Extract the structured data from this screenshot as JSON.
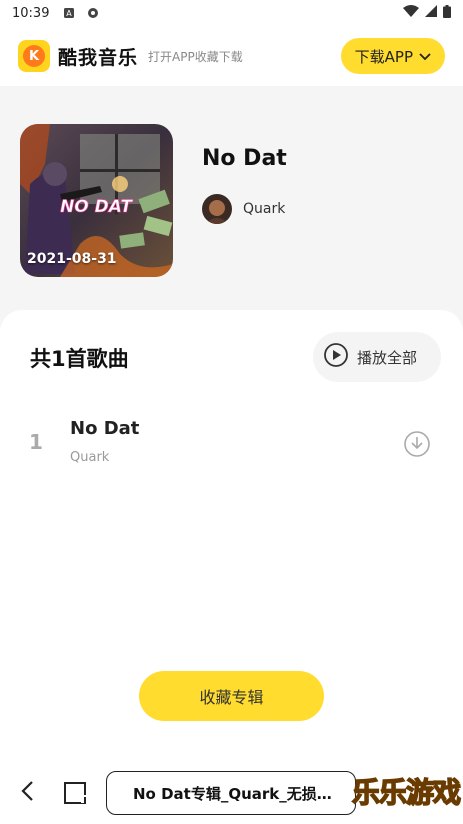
{
  "status_bar": {
    "time": "10:39"
  },
  "header": {
    "app_name": "酷我音乐",
    "tagline": "打开APP收藏下载",
    "download_button": "下载APP"
  },
  "album": {
    "title": "No Dat",
    "date": "2021-08-31",
    "artist": "Quark"
  },
  "list": {
    "count_label": "共1首歌曲",
    "play_all": "播放全部",
    "songs": [
      {
        "index": "1",
        "title": "No Dat",
        "artist": "Quark"
      }
    ]
  },
  "collect_button": "收藏专辑",
  "browser": {
    "url_title": "No Dat专辑_Quark_无损…",
    "watermark": "乐乐游戏"
  },
  "colors": {
    "accent": "#ffdc2e",
    "panel": "#ffffff",
    "background": "#f5f5f5"
  }
}
